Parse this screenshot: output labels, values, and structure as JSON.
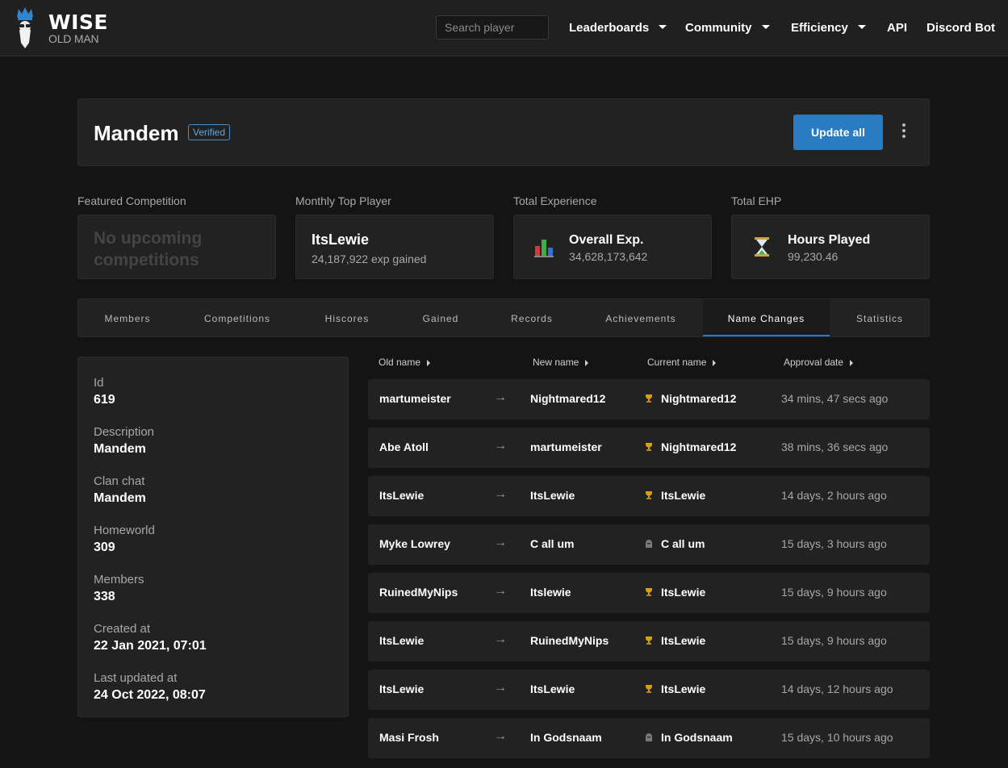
{
  "nav": {
    "logo_title": "WISE",
    "logo_subtitle": "OLD MAN",
    "search_placeholder": "Search player",
    "links": [
      "Leaderboards",
      "Community",
      "Efficiency",
      "API",
      "Discord Bot"
    ]
  },
  "group": {
    "name": "Mandem",
    "verified_label": "Verified",
    "update_button": "Update all"
  },
  "widgets": {
    "featured": {
      "label": "Featured Competition",
      "text": "No upcoming competitions"
    },
    "top_player": {
      "label": "Monthly Top Player",
      "name": "ItsLewie",
      "sub": "24,187,922 exp gained"
    },
    "total_exp": {
      "label": "Total Experience",
      "title": "Overall Exp.",
      "value": "34,628,173,642",
      "icon": "overall-skill-icon"
    },
    "total_ehp": {
      "label": "Total EHP",
      "title": "Hours Played",
      "value": "99,230.46",
      "icon": "hourglass-icon"
    }
  },
  "tabs": [
    "Members",
    "Competitions",
    "Hiscores",
    "Gained",
    "Records",
    "Achievements",
    "Name Changes",
    "Statistics"
  ],
  "active_tab": "Name Changes",
  "details": {
    "id_label": "Id",
    "id_value": "619",
    "description_label": "Description",
    "description_value": "Mandem",
    "clanchat_label": "Clan chat",
    "clanchat_value": "Mandem",
    "homeworld_label": "Homeworld",
    "homeworld_value": "309",
    "members_label": "Members",
    "members_value": "338",
    "created_label": "Created at",
    "created_value": "22 Jan 2021, 07:01",
    "updated_label": "Last updated at",
    "updated_value": "24 Oct 2022, 08:07"
  },
  "table": {
    "headers": {
      "old": "Old name",
      "new": "New name",
      "current": "Current name",
      "date": "Approval date"
    },
    "arrow": "→",
    "rows": [
      {
        "old": "martumeister",
        "new": "Nightmared12",
        "current": "Nightmared12",
        "role": "trophy",
        "date": "34 mins, 47 secs ago"
      },
      {
        "old": "Abe Atoll",
        "new": "martumeister",
        "current": "Nightmared12",
        "role": "trophy",
        "date": "38 mins, 36 secs ago"
      },
      {
        "old": "ItsLewie",
        "new": "ItsLewie",
        "current": "ItsLewie",
        "role": "trophy",
        "date": "14 days, 2 hours ago"
      },
      {
        "old": "Myke Lowrey",
        "new": "C all um",
        "current": "C all um",
        "role": "helm",
        "date": "15 days, 3 hours ago"
      },
      {
        "old": "RuinedMyNips",
        "new": "Itslewie",
        "current": "ItsLewie",
        "role": "trophy",
        "date": "15 days, 9 hours ago"
      },
      {
        "old": "ItsLewie",
        "new": "RuinedMyNips",
        "current": "ItsLewie",
        "role": "trophy",
        "date": "15 days, 9 hours ago"
      },
      {
        "old": "ItsLewie",
        "new": "ItsLewie",
        "current": "ItsLewie",
        "role": "trophy",
        "date": "14 days, 12 hours ago"
      },
      {
        "old": "Masi Frosh",
        "new": "In Godsnaam",
        "current": "In Godsnaam",
        "role": "helm",
        "date": "15 days, 10 hours ago"
      }
    ]
  }
}
